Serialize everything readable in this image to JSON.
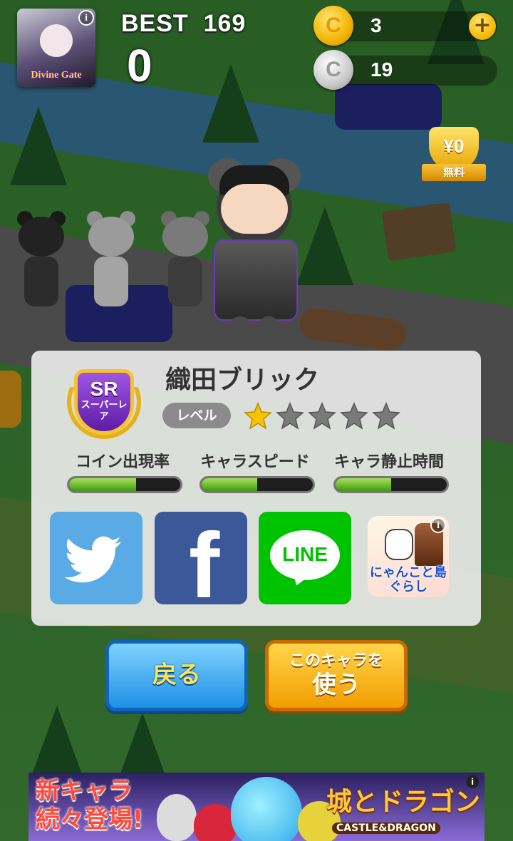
{
  "topbar": {
    "best_label": "BEST",
    "best_value": "169",
    "score": "0",
    "gold_coins": "3",
    "silver_coins": "19",
    "coin_symbol": "C",
    "plus_symbol": "+",
    "app_icon_title": "Divine Gate",
    "info_symbol": "i"
  },
  "free_badge": {
    "price": "¥0",
    "label": "無料"
  },
  "character": {
    "name": "織田ブリック",
    "rarity": "SR",
    "rarity_sub": "スーパーレア",
    "level_label": "レベル",
    "level_stars_filled": 1,
    "level_stars_total": 5
  },
  "stats": [
    {
      "label": "コイン出現率",
      "value": 0.6
    },
    {
      "label": "キャラスピード",
      "value": 0.5
    },
    {
      "label": "キャラ静止時間",
      "value": 0.5
    }
  ],
  "share": {
    "line_label": "LINE",
    "facebook_letter": "f"
  },
  "ad_tile": {
    "title": "にゃんこと島ぐらし"
  },
  "buttons": {
    "back": "戻る",
    "use_line1": "このキャラを",
    "use_line2": "使う"
  },
  "banner": {
    "left_line1": "新キャラ",
    "left_line2": "続々登場!",
    "right_title": "城とドラゴン",
    "right_sub": "CASTLE&DRAGON"
  },
  "colors": {
    "star_filled": "#f5c400",
    "star_empty": "#7a7a7a",
    "bar_fill": "#5cb82a",
    "twitter": "#5aaae6",
    "facebook": "#3b5998",
    "line": "#00c300"
  }
}
